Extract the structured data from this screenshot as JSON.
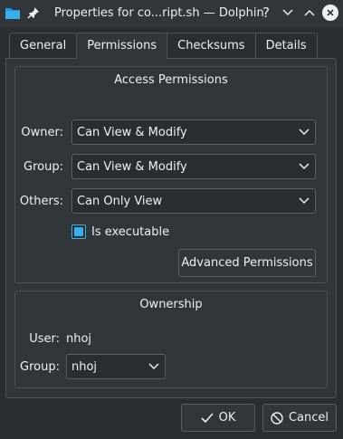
{
  "window": {
    "title": "Properties for co...ript.sh — Dolphin",
    "help_glyph": "?",
    "app_icon": "folder-icon",
    "pin_icon": "pin-icon"
  },
  "tabs": [
    {
      "label": "General"
    },
    {
      "label": "Permissions",
      "active": true
    },
    {
      "label": "Checksums"
    },
    {
      "label": "Details"
    }
  ],
  "access": {
    "title": "Access Permissions",
    "owner_label": "Owner:",
    "owner_value": "Can View & Modify",
    "group_label": "Group:",
    "group_value": "Can View & Modify",
    "others_label": "Others:",
    "others_value": "Can Only View",
    "executable_label": "Is executable",
    "executable_checked": true,
    "advanced_button": "Advanced Permissions"
  },
  "ownership": {
    "title": "Ownership",
    "user_label": "User:",
    "user_value": "nhoj",
    "group_label": "Group:",
    "group_value": "nhoj"
  },
  "buttons": {
    "ok": "OK",
    "cancel": "Cancel"
  },
  "colors": {
    "background": "#2a2e32",
    "accent": "#3daee9",
    "text": "#eff0f1"
  }
}
